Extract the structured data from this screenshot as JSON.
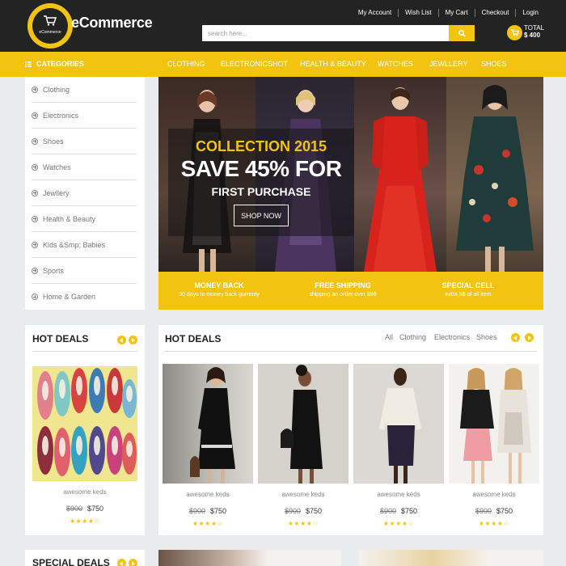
{
  "brand": {
    "name": "eCommerce",
    "badge_text": "eCommerce"
  },
  "top_links": [
    "My Account",
    "Wish List",
    "My Cart",
    "Checkout",
    "Login"
  ],
  "search": {
    "placeholder": "search here..."
  },
  "cart_total": {
    "label": "TOTAL",
    "amount": "$ 400"
  },
  "nav": {
    "categories_label": "CATEGORIES",
    "items": [
      "CLOTHING",
      "ELECTRONICSHOT",
      "HEALTH & BEAUTY",
      "WATCHES",
      "JEWLLERY",
      "SHOES"
    ]
  },
  "sidebar": {
    "items": [
      "Clothing",
      "Electronics",
      "Shoes",
      "Watches",
      "Jewllery",
      "Health & Beauty",
      "Kids &Smp; Babies",
      "Sports",
      "Home & Garden"
    ]
  },
  "banner": {
    "collection": "COLLECTION 2015",
    "headline": "SAVE 45% FOR",
    "subhead": "FIRST PURCHASE",
    "cta": "SHOP NOW"
  },
  "features": [
    {
      "title": "MONEY BACK",
      "subtitle": "30 days to money back gurrenty"
    },
    {
      "title": "FREE SHIPPING",
      "subtitle": "shipping an order over $99"
    },
    {
      "title": "SPECIAL CELL",
      "subtitle": "extra 5$ of all item"
    }
  ],
  "hot_deals_side": {
    "title": "HOT DEALS",
    "product": {
      "name": "awesome keds",
      "old_price": "$900",
      "price": "$750",
      "rating": 4
    }
  },
  "hot_deals_main": {
    "title": "HOT DEALS",
    "tabs": [
      "All",
      "Clothing",
      "Electronics",
      "Shoes"
    ],
    "products": [
      {
        "name": "awesome keds",
        "old_price": "$900",
        "price": "$750",
        "rating": 4
      },
      {
        "name": "awesome keds",
        "old_price": "$900",
        "price": "$750",
        "rating": 4
      },
      {
        "name": "awesome keds",
        "old_price": "$900",
        "price": "$750",
        "rating": 4
      },
      {
        "name": "awesome keds",
        "old_price": "$900",
        "price": "$750",
        "rating": 4
      }
    ]
  },
  "special_deals": {
    "title": "SPECIAL DEALS"
  },
  "colors": {
    "accent": "#f2c40f",
    "header": "#232323",
    "background": "#e9ecee"
  }
}
